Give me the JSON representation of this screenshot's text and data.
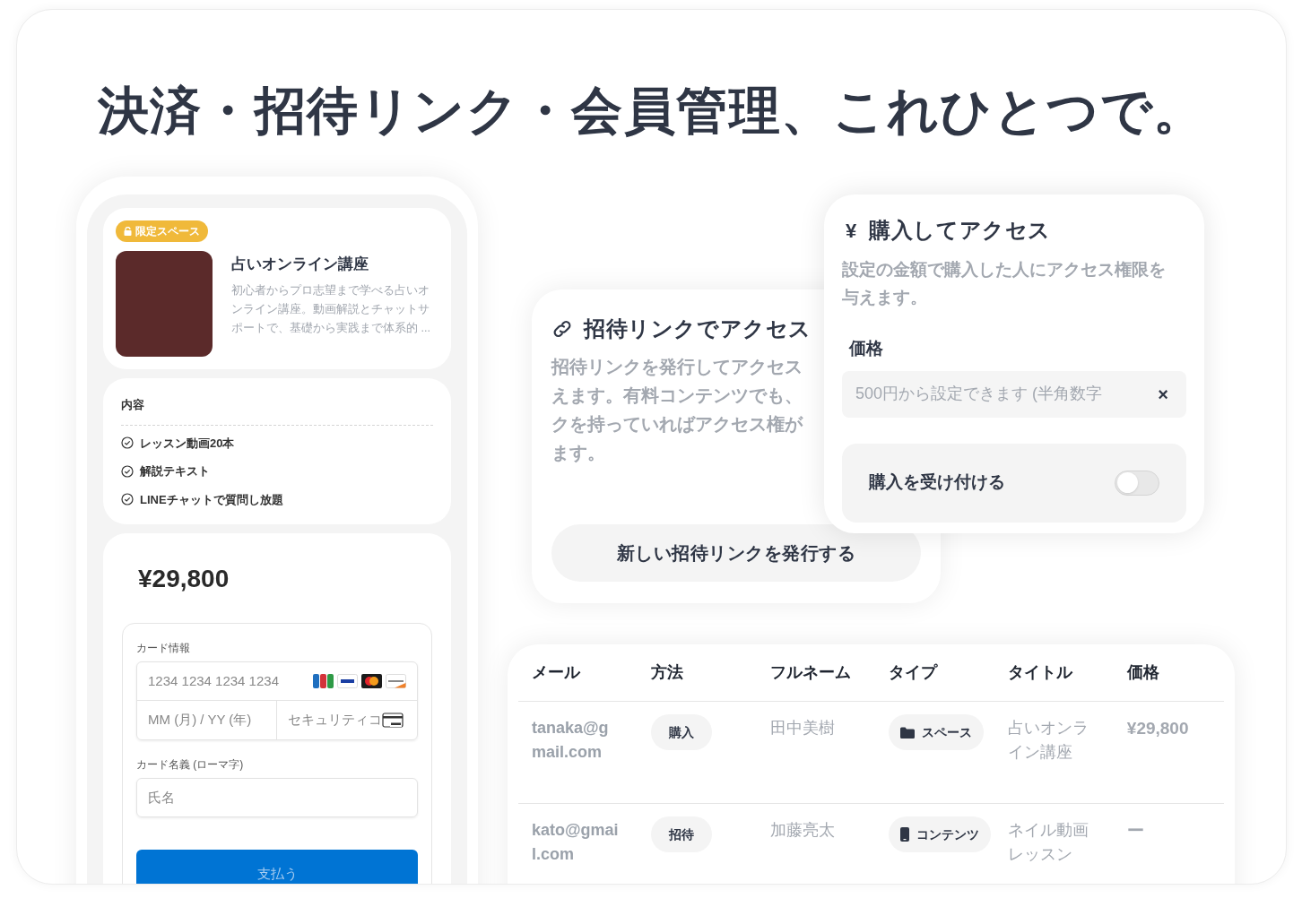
{
  "headline": "決済・招待リンク・会員管理、これひとつで。",
  "phone": {
    "badge": "限定スペース",
    "title": "占いオンライン講座",
    "description": "初心者からプロ志望まで学べる占いオンライン講座。動画解説とチャットサポートで、基礎から実践まで体系的 ...",
    "section_title": "内容",
    "features": [
      "レッスン動画20本",
      "解説テキスト",
      "LINEチャットで質問し放題"
    ],
    "price": "¥29,800",
    "card_form": {
      "label": "カード情報",
      "number_placeholder": "1234 1234 1234 1234",
      "expiry_placeholder": "MM (月) / YY (年)",
      "cvc_placeholder": "セキュリティコ",
      "name_label": "カード名義 (ローマ字)",
      "name_placeholder": "氏名"
    },
    "pay_button": "支払う"
  },
  "invite_card": {
    "title": "招待リンクでアクセス",
    "description_lines": [
      "招待リンクを発行してアクセス",
      "えます。有料コンテンツでも、",
      "クを持っていればアクセス権が",
      "ます。"
    ],
    "button": "新しい招待リンクを発行する"
  },
  "purchase_card": {
    "icon": "¥",
    "title": "購入してアクセス",
    "description": "設定の金額で購入した人にアクセス権限を与えます。",
    "price_label": "価格",
    "price_placeholder": "500円から設定できます (半角数字",
    "clear": "×",
    "accept_label": "購入を受け付ける",
    "accept_on": false
  },
  "table": {
    "columns": [
      "メール",
      "方法",
      "フルネーム",
      "タイプ",
      "タイトル",
      "価格"
    ],
    "rows": [
      {
        "email": "tanaka@gmail.com",
        "method": "購入",
        "full_name": "田中美樹",
        "type": {
          "kind": "space",
          "label": "スペース"
        },
        "title": "占いオンライン講座",
        "price": "¥29,800"
      },
      {
        "email": "kato@gmail.com",
        "method": "招待",
        "full_name": "加藤亮太",
        "type": {
          "kind": "content",
          "label": "コンテンツ"
        },
        "title": "ネイル動画レッスン",
        "price": "ー"
      }
    ]
  }
}
